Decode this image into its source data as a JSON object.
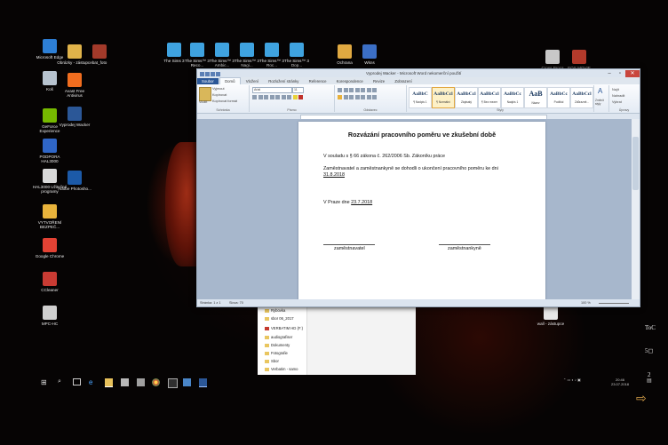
{
  "desktop_icons": [
    {
      "label": "Microsoft Edge",
      "color": "#2d7fd6"
    },
    {
      "label": "Obrázky - zástupce",
      "color": "#e0b34a"
    },
    {
      "label": "bat_foto",
      "color": "#a33a2a"
    },
    {
      "label": "Koš",
      "color": "#b7c3cf"
    },
    {
      "label": "Avast Free Antivirus",
      "color": "#f06d1f"
    },
    {
      "label": "GeForce Experience",
      "color": "#76b900"
    },
    {
      "label": "Vyprodej Wacker",
      "color": "#2b5797"
    },
    {
      "label": "PODPORA HAL3000",
      "color": "#2f66c7"
    },
    {
      "label": "HAL3000 Užitečné programy",
      "color": "#d9d9d9"
    },
    {
      "label": "Adobe Photosho...",
      "color": "#1c5aa8"
    },
    {
      "label": "VYTVOŘENÍ BEZPEČ...",
      "color": "#e8b33b"
    },
    {
      "label": "Google Chrome",
      "color": "#e34234"
    },
    {
      "label": "CCleaner",
      "color": "#c93b33"
    },
    {
      "label": "MPC-HC",
      "color": "#cfcfcf"
    },
    {
      "label": "The Sims 3",
      "color": "#3fa3e0"
    },
    {
      "label": "The Sims™ 3 Reco...",
      "color": "#3fa3e0"
    },
    {
      "label": "The Sims™ 3 Ambic...",
      "color": "#3fa3e0"
    },
    {
      "label": "The Sims™ 3 Nagi...",
      "color": "#3fa3e0"
    },
    {
      "label": "The Sims™ 3 Roc...",
      "color": "#3fa3e0"
    },
    {
      "label": "The Sims™ 3 Dop...",
      "color": "#3fa3e0"
    },
    {
      "label": "Ochrana",
      "color": "#e0a941"
    },
    {
      "label": "Wkns",
      "color": "#3b6fc6"
    },
    {
      "label": "Cross Procs",
      "color": "#c8c8c8"
    },
    {
      "label": "EOS MOVIE",
      "color": "#b23a2b"
    },
    {
      "label": "wall - zástupce",
      "color": "#e7e7e7"
    }
  ],
  "word": {
    "title": "Vyprodej Wacker - Microsoft Word nekomerční použití",
    "tabs": [
      "Soubor",
      "Domů",
      "Vložení",
      "Rozložení stránky",
      "Reference",
      "Korespondence",
      "Revize",
      "Zobrazení"
    ],
    "active_tab": "Domů",
    "clipboard": {
      "paste": "Vložit",
      "cut": "Vyjmout",
      "copy": "Kopírovat",
      "format_painter": "Kopírovat formát",
      "group": "Schránka"
    },
    "font": {
      "name": "Arial",
      "size": "11",
      "group": "Písmo"
    },
    "paragraph_group": "Odstavec",
    "styles": [
      {
        "preview": "AaBbC",
        "name": "¶ Nadpis 1"
      },
      {
        "preview": "AaBbCcl",
        "name": "¶ Normální",
        "selected": true
      },
      {
        "preview": "AaBbCcl",
        "name": "Zápisatý"
      },
      {
        "preview": "AaBbCcl",
        "name": "¶ Bez mezer"
      },
      {
        "preview": "AaBbCc",
        "name": "Nadpis 1"
      },
      {
        "preview": "AaB",
        "name": "Název"
      },
      {
        "preview": "AaBbCc",
        "name": "Podtitul"
      },
      {
        "preview": "AaBbCcl",
        "name": "Zdůrazně..."
      }
    ],
    "styles_group": "Styly",
    "change_styles": "Změnit styly",
    "editing": {
      "find": "Najít",
      "replace": "Nahradit",
      "select": "Vybrat",
      "group": "Úpravy"
    },
    "document": {
      "title": "Rozvázání pracovního poměru ve zkušební době",
      "para1": "V souladu s § 66 zákona č. 262/2006 Sb. Zákoníku práce",
      "para2_a": "Zaměstnavatel a zaměstnankyně se dohodli o ukončení pracovního poměru ke dni",
      "para2_date": "31.8.2018",
      "place_prefix": "V Praze dne ",
      "place_date": "23.7.2018",
      "sig_left": "zaměstnavatel",
      "sig_right": "zaměstnankyně"
    },
    "status": {
      "page": "Stránka: 1 z 1",
      "words": "Slova: 70",
      "zoom": "100 %"
    }
  },
  "explorer_items": [
    {
      "label": "Rybovka",
      "type": "folder"
    },
    {
      "label": "sbor 06_2017",
      "type": "folder"
    },
    {
      "label": "VERBATIM HD (F:)",
      "type": "drive"
    },
    {
      "label": "audiografiser",
      "type": "folder"
    },
    {
      "label": "Dokumenty",
      "type": "folder"
    },
    {
      "label": "Fotografie",
      "type": "folder"
    },
    {
      "label": "Sbor",
      "type": "folder"
    },
    {
      "label": "Verbatim - samo",
      "type": "folder"
    }
  ],
  "tray": {
    "time": "20:46",
    "date": "23.07.2018"
  },
  "side_labels": [
    "ToC",
    "5◻",
    "2"
  ]
}
